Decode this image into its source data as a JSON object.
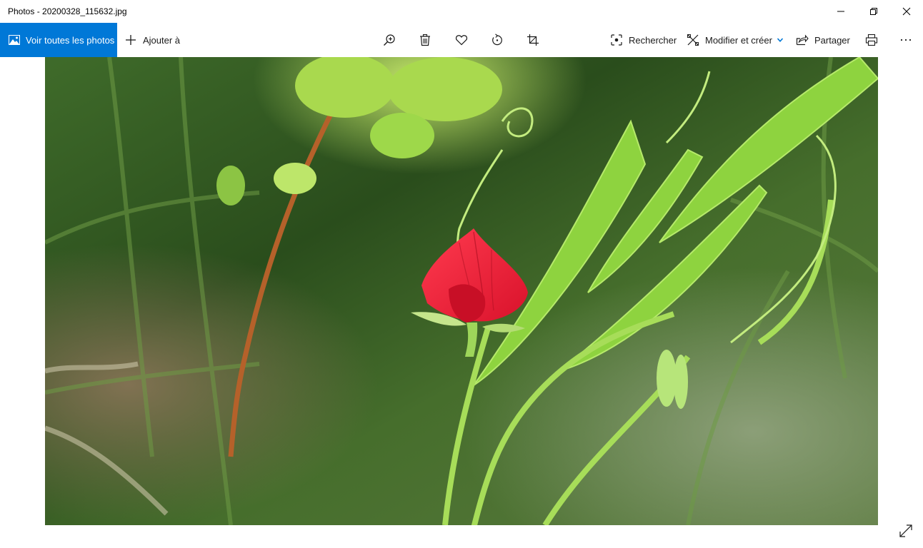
{
  "window": {
    "title": "Photos - 20200328_115632.jpg"
  },
  "toolbar": {
    "view_all_label": "Voir toutes les photos",
    "add_to_label": "Ajouter à",
    "search_label": "Rechercher",
    "edit_create_label": "Modifier et créer",
    "share_label": "Partager"
  },
  "icons": {
    "zoom": "zoom-in-icon",
    "delete": "trash-icon",
    "favorite": "heart-icon",
    "rotate": "rotate-icon",
    "crop": "crop-icon",
    "print": "printer-icon",
    "more": "more-icon",
    "fullscreen": "expand-icon"
  },
  "colors": {
    "accent": "#0078d7"
  }
}
